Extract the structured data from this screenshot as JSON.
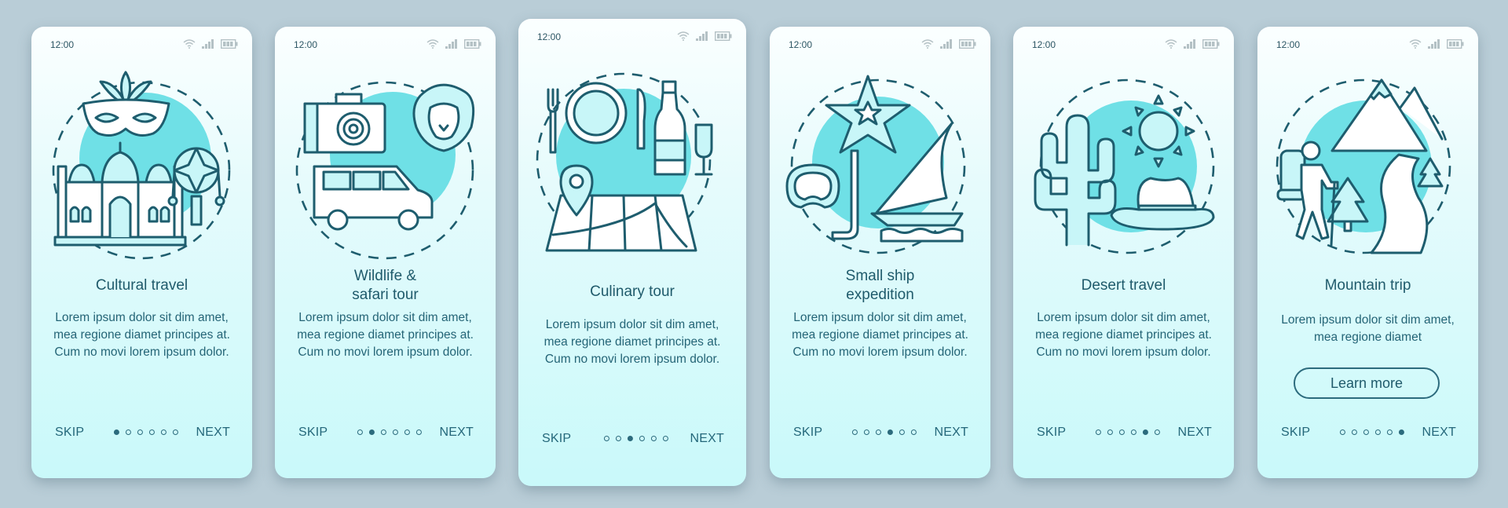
{
  "status_bar": {
    "time": "12:00",
    "icons": [
      "wifi-icon",
      "signal-icon",
      "battery-icon"
    ]
  },
  "colors": {
    "accent": "#1e5d6e",
    "blob": "#6fe0e6",
    "background": "#b9cdd7",
    "card_top": "#fbffff",
    "card_bottom": "#c9f9fa"
  },
  "nav": {
    "skip_label": "SKIP",
    "next_label": "NEXT",
    "total_steps": 6
  },
  "screens": [
    {
      "title": "Cultural travel",
      "body": "Lorem ipsum dolor sit dim amet, mea regione diamet principes at. Cum no movi lorem ipsum dolor.",
      "active_step": 1,
      "illustration": [
        "carnival-mask-icon",
        "mosque-icon",
        "hand-drum-icon"
      ]
    },
    {
      "title": "Wildlife & safari tour",
      "title_lines": [
        "Wildlife &",
        "safari tour"
      ],
      "body": "Lorem ipsum dolor sit dim amet, mea regione diamet principes at. Cum no movi lorem ipsum dolor.",
      "active_step": 2,
      "illustration": [
        "camera-icon",
        "lion-icon",
        "van-icon"
      ]
    },
    {
      "title": "Culinary tour",
      "body": "Lorem ipsum dolor sit dim amet, mea regione diamet principes at. Cum no movi lorem ipsum dolor.",
      "active_step": 3,
      "illustration": [
        "fork-icon",
        "plate-icon",
        "knife-icon",
        "bottle-icon",
        "wine-glass-icon",
        "map-pin-icon"
      ]
    },
    {
      "title": "Small ship expedition",
      "title_lines": [
        "Small ship",
        "expedition"
      ],
      "body": "Lorem ipsum dolor sit dim amet, mea regione diamet principes at. Cum no movi lorem ipsum dolor.",
      "active_step": 4,
      "illustration": [
        "starfish-icon",
        "diving-mask-icon",
        "snorkel-icon",
        "sailboat-icon"
      ]
    },
    {
      "title": "Desert travel",
      "body": "Lorem ipsum dolor sit dim amet, mea regione diamet principes at. Cum no movi lorem ipsum dolor.",
      "active_step": 5,
      "illustration": [
        "cactus-icon",
        "sun-icon",
        "hat-icon"
      ]
    },
    {
      "title": "Mountain trip",
      "body": "Lorem ipsum dolor sit dim amet, mea regione diamet",
      "active_step": 6,
      "button_label": "Learn more",
      "illustration": [
        "mountains-icon",
        "hiker-icon",
        "pine-tree-icon",
        "river-icon"
      ]
    }
  ]
}
